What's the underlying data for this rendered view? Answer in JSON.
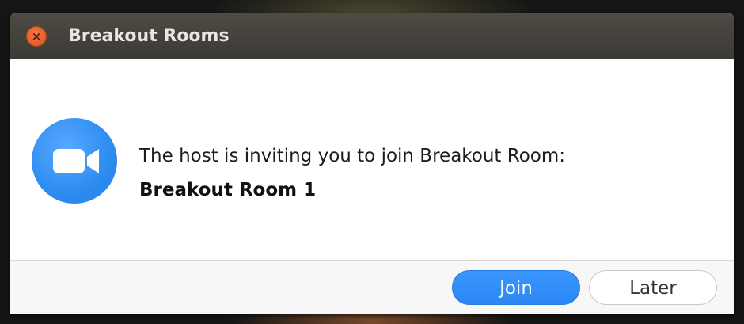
{
  "window": {
    "title": "Breakout Rooms",
    "close_icon": "close-icon",
    "close_glyph": "×"
  },
  "dialog": {
    "icon": "video-camera-icon",
    "message": "The host is inviting you to join Breakout Room:",
    "room_name": "Breakout Room 1"
  },
  "buttons": {
    "join_label": "Join",
    "later_label": "Later"
  },
  "colors": {
    "titlebar": "#3c3a35",
    "close_button": "#e65a2b",
    "app_icon": "#2d8cf0",
    "join_button": "#2a86f2"
  }
}
